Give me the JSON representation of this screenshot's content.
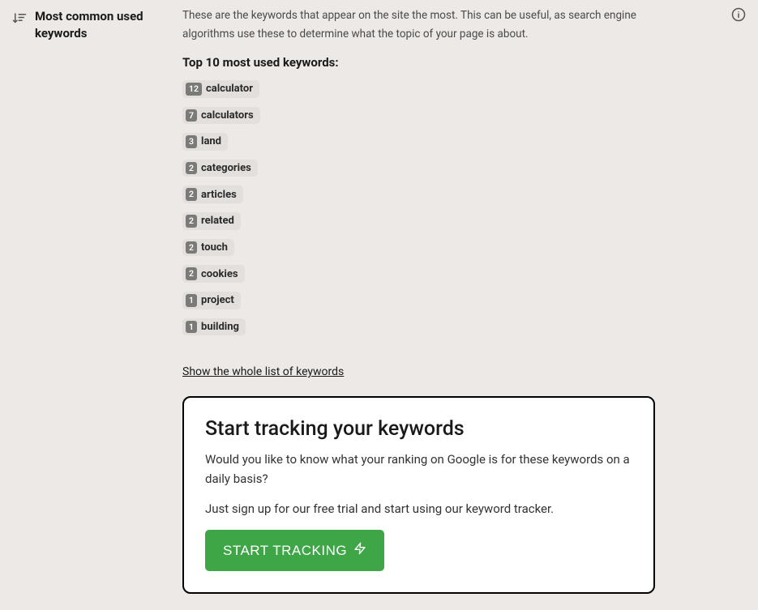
{
  "section": {
    "title": "Most common used keywords",
    "description": "These are the keywords that appear on the site the most. This can be useful, as search engine algorithms use these to determine what the topic of your page is about.",
    "subheading": "Top 10 most used keywords:"
  },
  "keywords": [
    {
      "count": "12",
      "label": "calculator"
    },
    {
      "count": "7",
      "label": "calculators"
    },
    {
      "count": "3",
      "label": "land"
    },
    {
      "count": "2",
      "label": "categories"
    },
    {
      "count": "2",
      "label": "articles"
    },
    {
      "count": "2",
      "label": "related"
    },
    {
      "count": "2",
      "label": "touch"
    },
    {
      "count": "2",
      "label": "cookies"
    },
    {
      "count": "1",
      "label": "project"
    },
    {
      "count": "1",
      "label": "building"
    }
  ],
  "show_all_label": "Show the whole list of keywords",
  "promo": {
    "title": "Start tracking your keywords",
    "line1": "Would you like to know what your ranking on Google is for these keywords on a daily basis?",
    "line2": "Just sign up for our free trial and start using our keyword tracker.",
    "cta": "START TRACKING"
  }
}
